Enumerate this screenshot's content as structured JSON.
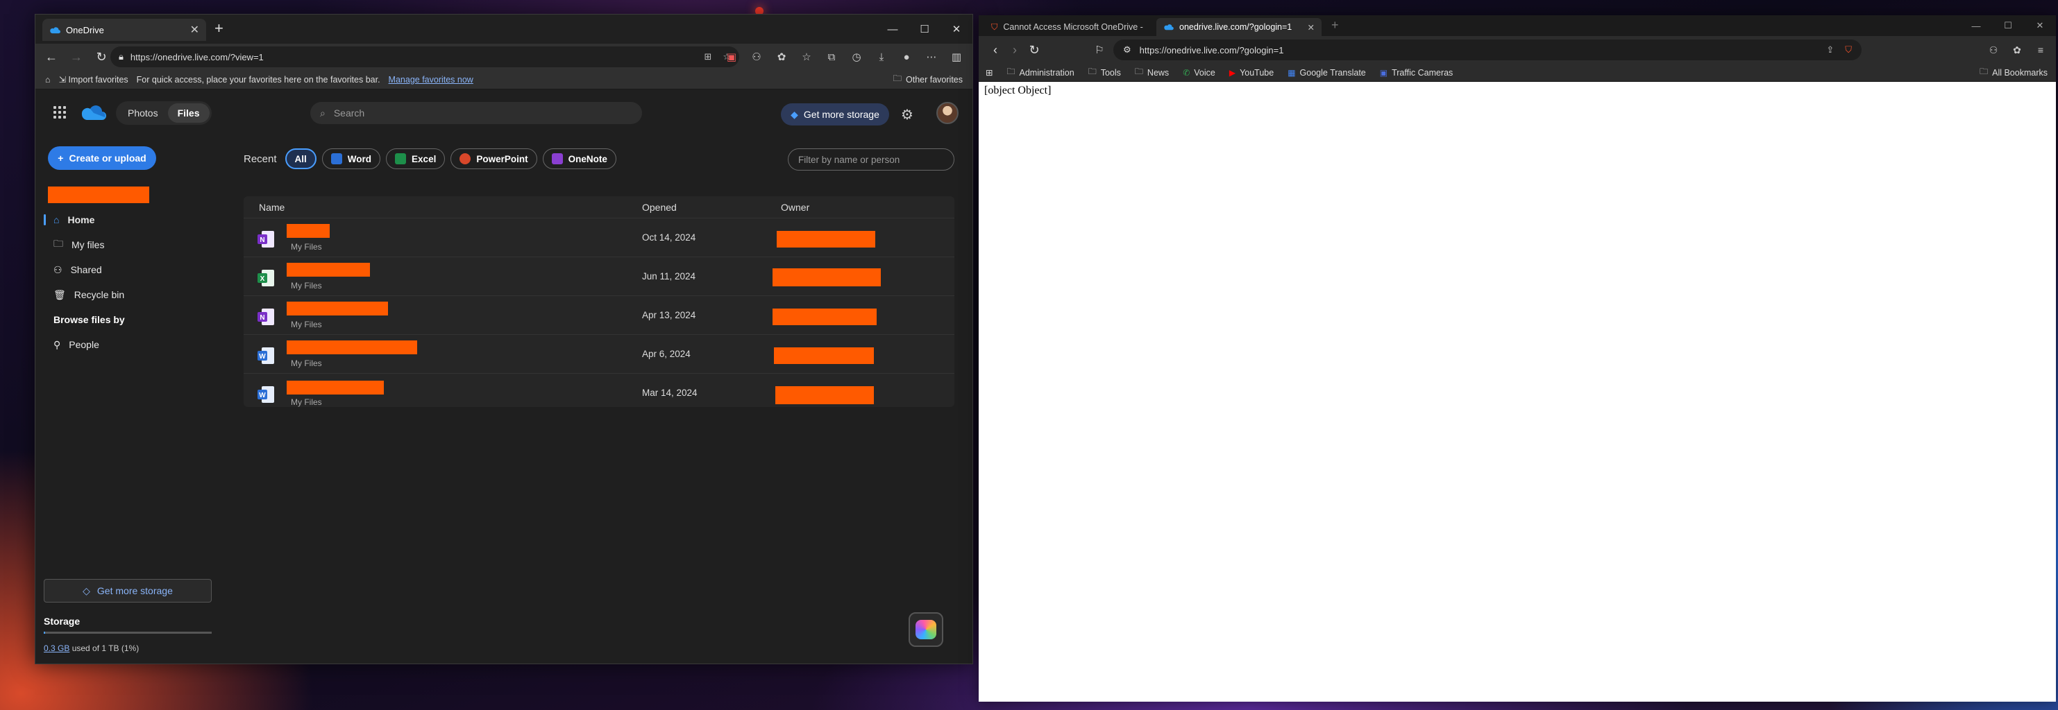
{
  "edge": {
    "tab_title": "OneDrive",
    "url": "https://onedrive.live.com/?view=1",
    "favbar": {
      "import_label": "Import favorites",
      "message": "For quick access, place your favorites here on the favorites bar.",
      "manage_link": "Manage favorites now",
      "other_favorites": "Other favorites"
    }
  },
  "onedrive": {
    "switch": {
      "photos": "Photos",
      "files": "Files"
    },
    "search_placeholder": "Search",
    "get_more_storage_top": "Get more storage",
    "create_button": "Create or upload",
    "nav": {
      "home": "Home",
      "my_files": "My files",
      "shared": "Shared",
      "recycle_bin": "Recycle bin",
      "browse_heading": "Browse files by",
      "people": "People"
    },
    "get_more_storage_side": "Get more storage",
    "storage": {
      "title": "Storage",
      "used_link": "0.3 GB",
      "used_rest": " used of 1 TB (1%)",
      "percent": 0.01
    },
    "filters": {
      "label": "Recent",
      "chips": [
        "All",
        "Word",
        "Excel",
        "PowerPoint",
        "OneNote"
      ],
      "filter_placeholder": "Filter by name or person"
    },
    "table": {
      "headers": {
        "name": "Name",
        "opened": "Opened",
        "owner": "Owner"
      },
      "rows": [
        {
          "type": "onenote-icon",
          "location": "My Files",
          "opened": "Oct 14, 2024"
        },
        {
          "type": "excel-icon",
          "location": "My Files",
          "opened": "Jun 11, 2024"
        },
        {
          "type": "onenote-icon",
          "location": "My Files",
          "opened": "Apr 13, 2024"
        },
        {
          "type": "word-icon",
          "location": "My Files",
          "opened": "Apr 6, 2024"
        },
        {
          "type": "word-icon",
          "location": "My Files",
          "opened": "Mar 14, 2024"
        }
      ]
    }
  },
  "brave": {
    "tabs": [
      "Cannot Access Microsoft OneDrive -",
      "onedrive.live.com/?gologin=1"
    ],
    "url": "https://onedrive.live.com/?gologin=1",
    "bookmarks": [
      "Administration",
      "Tools",
      "News",
      "Voice",
      "YouTube",
      "Google Translate",
      "Traffic Cameras"
    ],
    "all_bookmarks": "All Bookmarks",
    "page_text": "[object Object]"
  },
  "colors": {
    "accent_blue": "#2e7be6",
    "redaction": "#ff5a00"
  }
}
